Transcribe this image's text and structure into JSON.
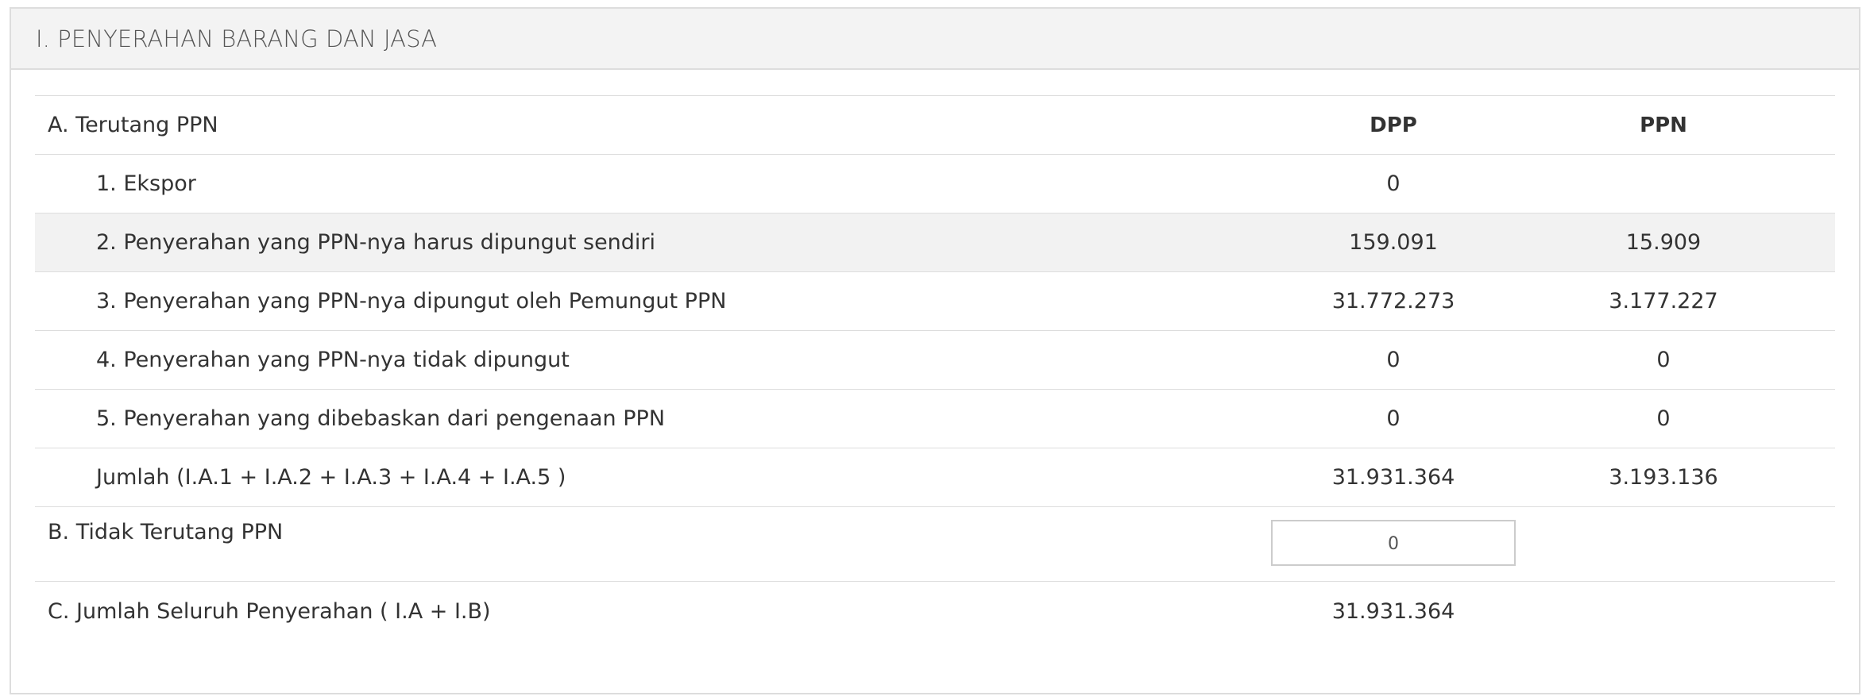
{
  "panel": {
    "title": "I. PENYERAHAN BARANG DAN JASA"
  },
  "header": {
    "label": "A. Terutang PPN",
    "dpp": "DPP",
    "ppn": "PPN"
  },
  "rows": [
    {
      "label": "1. Ekspor",
      "dpp": "0",
      "ppn": ""
    },
    {
      "label": "2. Penyerahan yang PPN-nya harus dipungut sendiri",
      "dpp": "159.091",
      "ppn": "15.909"
    },
    {
      "label": "3. Penyerahan yang PPN-nya dipungut oleh Pemungut PPN",
      "dpp": "31.772.273",
      "ppn": "3.177.227"
    },
    {
      "label": "4. Penyerahan yang PPN-nya tidak dipungut",
      "dpp": "0",
      "ppn": "0"
    },
    {
      "label": "5. Penyerahan yang dibebaskan dari pengenaan PPN",
      "dpp": "0",
      "ppn": "0"
    },
    {
      "label": "Jumlah (I.A.1 + I.A.2 + I.A.3 + I.A.4 + I.A.5 )",
      "dpp": "31.931.364",
      "ppn": "3.193.136"
    }
  ],
  "tidak_terutang": {
    "label": "B. Tidak Terutang PPN",
    "value": "0"
  },
  "jumlah_seluruh": {
    "label": "C. Jumlah Seluruh Penyerahan ( I.A + I.B)",
    "dpp": "31.931.364"
  }
}
